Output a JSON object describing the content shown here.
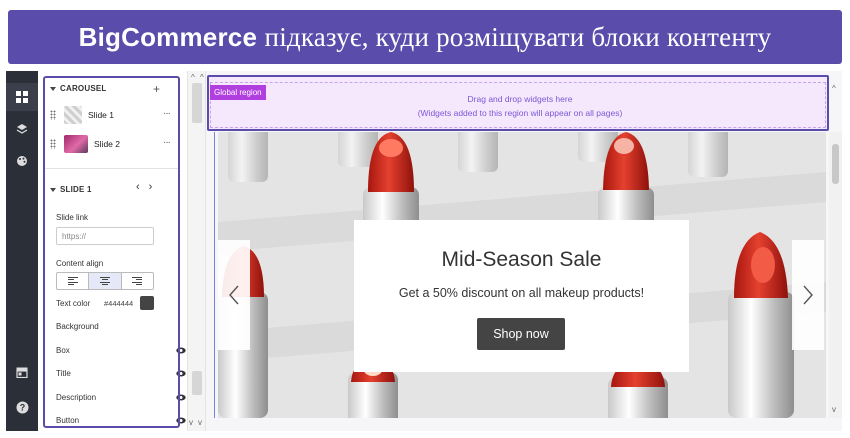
{
  "banner": {
    "title_bold": "BigCommerce",
    "title_rest": "підказує, куди розміщувати блоки контенту",
    "background": "#5a4caa"
  },
  "rail": {
    "icons": [
      "widgets-icon",
      "layers-icon",
      "palette-icon",
      "storefront-icon",
      "help-icon"
    ]
  },
  "panel": {
    "carousel_header": "CAROUSEL",
    "add_symbol": "+",
    "slides": [
      {
        "label": "Slide 1"
      },
      {
        "label": "Slide 2"
      }
    ],
    "more_symbol": "···",
    "slide_section_header": "SLIDE 1",
    "prev_symbol": "‹",
    "next_symbol": "›",
    "slide_link_label": "Slide link",
    "slide_link_placeholder": "https://",
    "content_align_label": "Content align",
    "text_color_label": "Text color",
    "text_color_value": "#444444",
    "properties": [
      {
        "label": "Background",
        "eye": false
      },
      {
        "label": "Box",
        "eye": true
      },
      {
        "label": "Title",
        "eye": true
      },
      {
        "label": "Description",
        "eye": true
      },
      {
        "label": "Button",
        "eye": true
      }
    ]
  },
  "canvas": {
    "region_tag": "Global region",
    "region_line1": "Drag and drop widgets here",
    "region_line2": "(Widgets added to this region will appear on all pages)",
    "promo": {
      "title": "Mid-Season Sale",
      "subtitle": "Get a 50% discount on all makeup products!",
      "button": "Shop now"
    }
  },
  "colors": {
    "highlight": "#5a4caa",
    "region_bg": "#f5e8fc",
    "tag": "#b13fe0",
    "rail": "#2b2f38"
  }
}
